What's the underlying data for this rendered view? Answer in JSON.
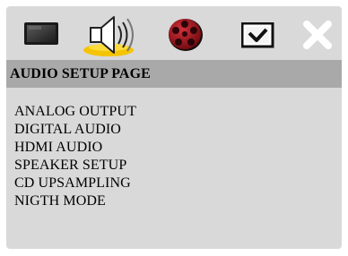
{
  "icons": [
    {
      "name": "general-setup-icon",
      "selected": false
    },
    {
      "name": "speaker-audio-icon",
      "selected": true
    },
    {
      "name": "video-reel-icon",
      "selected": false
    },
    {
      "name": "preference-checkbox-icon",
      "selected": false
    },
    {
      "name": "exit-x-icon",
      "selected": false
    }
  ],
  "colors": {
    "panel": "#d9d9d9",
    "header": "#a9a9a9",
    "selection_glow": "#f5c400",
    "reel": "#a8141e"
  },
  "header": {
    "title": "AUDIO SETUP PAGE"
  },
  "menu": {
    "items": [
      {
        "label": "ANALOG OUTPUT"
      },
      {
        "label": "DIGITAL AUDIO"
      },
      {
        "label": "HDMI AUDIO"
      },
      {
        "label": "SPEAKER SETUP"
      },
      {
        "label": "CD UPSAMPLING"
      },
      {
        "label": "NIGTH MODE"
      }
    ]
  }
}
